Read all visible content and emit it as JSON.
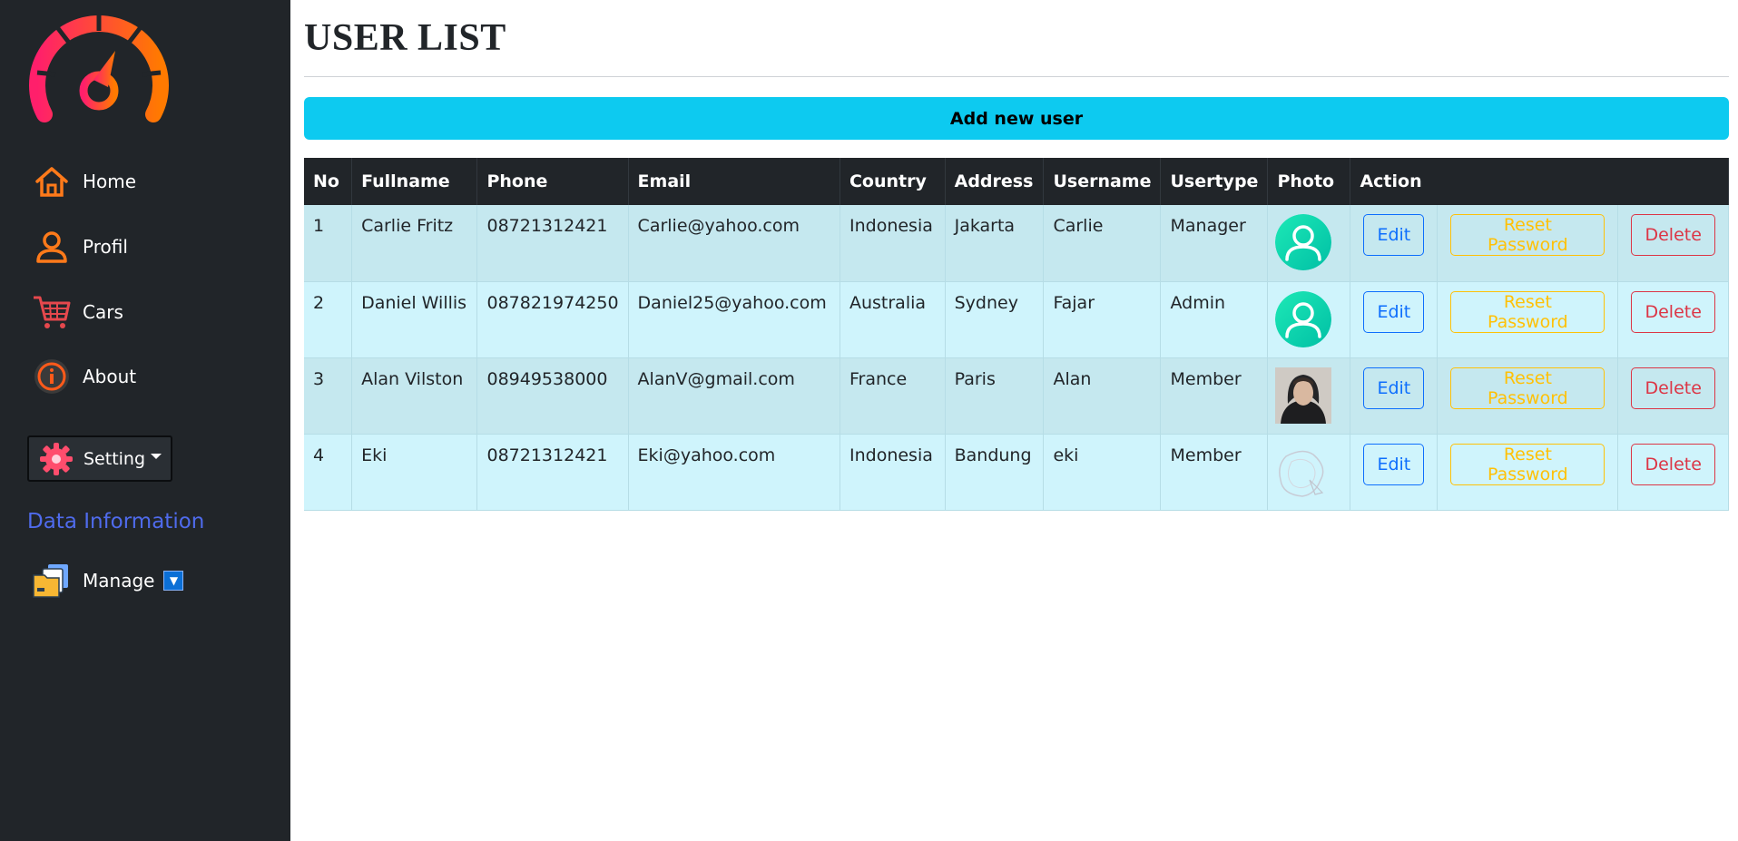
{
  "sidebar": {
    "nav": [
      {
        "label": "Home",
        "icon": "home-icon"
      },
      {
        "label": "Profil",
        "icon": "user-icon"
      },
      {
        "label": "Cars",
        "icon": "cart-icon"
      },
      {
        "label": "About",
        "icon": "info-icon"
      }
    ],
    "setting_label": "Setting",
    "section_title": "Data Information",
    "manage_label": "Manage",
    "manage_dropdown_glyph": "▼"
  },
  "main": {
    "title": "USER LIST",
    "add_button": "Add new user",
    "table": {
      "headers": [
        "No",
        "Fullname",
        "Phone",
        "Email",
        "Country",
        "Address",
        "Username",
        "Usertype",
        "Photo",
        "Action"
      ],
      "rows": [
        {
          "no": "1",
          "fullname": "Carlie Fritz",
          "phone": "08721312421",
          "email": "Carlie@yahoo.com",
          "country": "Indonesia",
          "address": "Jakarta",
          "username": "Carlie",
          "usertype": "Manager",
          "photo": "default-avatar"
        },
        {
          "no": "2",
          "fullname": "Daniel Willis",
          "phone": "087821974250",
          "email": "Daniel25@yahoo.com",
          "country": "Australia",
          "address": "Sydney",
          "username": "Fajar",
          "usertype": "Admin",
          "photo": "default-avatar"
        },
        {
          "no": "3",
          "fullname": "Alan Vilston",
          "phone": "08949538000",
          "email": "AlanV@gmail.com",
          "country": "France",
          "address": "Paris",
          "username": "Alan",
          "usertype": "Member",
          "photo": "person-photo"
        },
        {
          "no": "4",
          "fullname": "Eki",
          "phone": "08721312421",
          "email": "Eki@yahoo.com",
          "country": "Indonesia",
          "address": "Bandung",
          "username": "eki",
          "usertype": "Member",
          "photo": "sketch-image"
        }
      ],
      "actions": {
        "edit": "Edit",
        "reset": "Reset Password",
        "delete": "Delete"
      }
    }
  },
  "colors": {
    "sidebar_bg": "#212529",
    "accent_cyan": "#0dcaf0",
    "section_title": "#4f6bec",
    "edit": "#0d6efd",
    "reset": "#ffc107",
    "delete": "#dc3545",
    "row_odd": "#c5e8ef",
    "row_even": "#cff4fc"
  }
}
